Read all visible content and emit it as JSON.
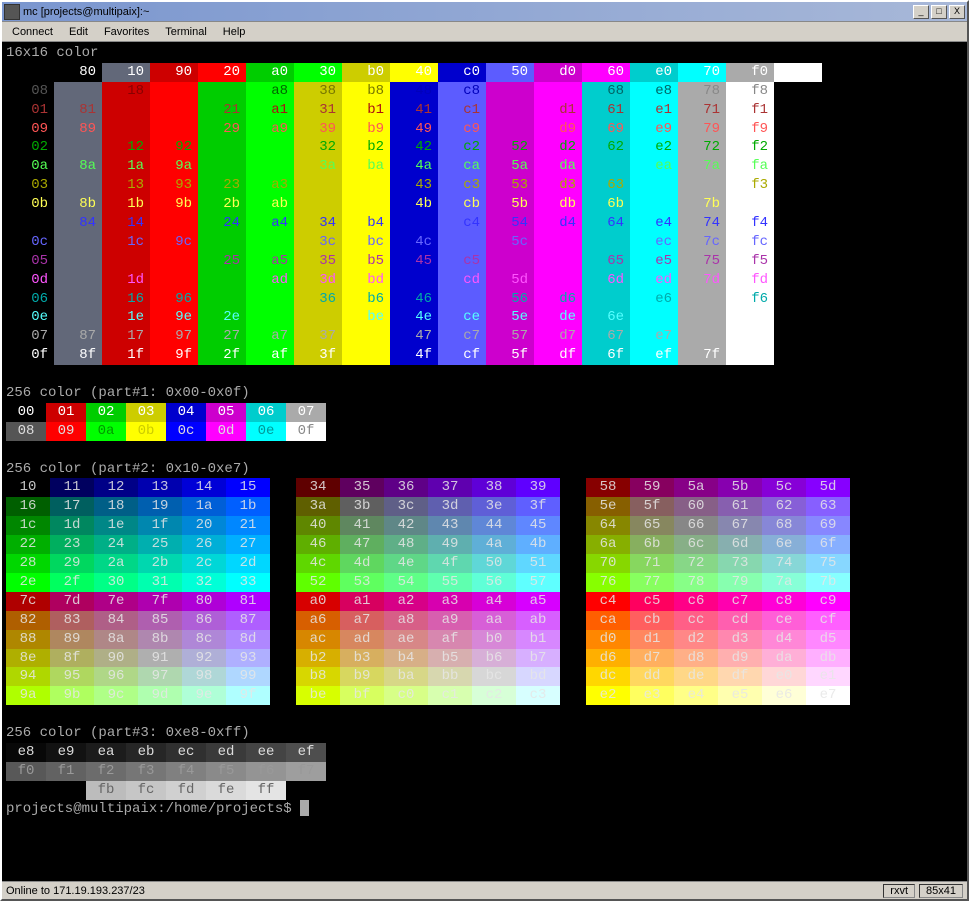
{
  "window": {
    "title": "mc [projects@multipaix]:~",
    "btn_min": "_",
    "btn_max": "□",
    "btn_close": "X"
  },
  "menu": [
    "Connect",
    "Edit",
    "Favorites",
    "Terminal",
    "Help"
  ],
  "term": {
    "h1": "16x16 color",
    "grid16_cols": [
      "",
      "80",
      "10",
      "90",
      "20",
      "a0",
      "30",
      "b0",
      "40",
      "c0",
      "50",
      "d0",
      "60",
      "e0",
      "70",
      "f0"
    ],
    "grid16_rows": [
      [
        "08",
        "",
        "18",
        "",
        "",
        "a8",
        "38",
        "b8",
        "48",
        "c8",
        "",
        "",
        "68",
        "e8",
        "78",
        "f8"
      ],
      [
        "01",
        "81",
        "",
        "",
        "21",
        "a1",
        "31",
        "b1",
        "41",
        "c1",
        "",
        "d1",
        "61",
        "e1",
        "71",
        "f1"
      ],
      [
        "09",
        "89",
        "",
        "",
        "29",
        "a9",
        "39",
        "b9",
        "49",
        "c9",
        "",
        "d9",
        "69",
        "e9",
        "79",
        "f9"
      ],
      [
        "02",
        "",
        "12",
        "92",
        "",
        "",
        "32",
        "b2",
        "42",
        "c2",
        "52",
        "d2",
        "62",
        "e2",
        "72",
        "f2"
      ],
      [
        "0a",
        "8a",
        "1a",
        "9a",
        "",
        "",
        "3a",
        "ba",
        "4a",
        "ca",
        "5a",
        "da",
        "",
        "ea",
        "7a",
        "fa"
      ],
      [
        "03",
        "",
        "13",
        "93",
        "23",
        "a3",
        "",
        "",
        "43",
        "c3",
        "53",
        "d3",
        "63",
        "",
        "",
        "f3"
      ],
      [
        "0b",
        "8b",
        "1b",
        "9b",
        "2b",
        "ab",
        "",
        "",
        "4b",
        "cb",
        "5b",
        "db",
        "6b",
        "",
        "7b",
        ""
      ],
      [
        "",
        "84",
        "14",
        "",
        "24",
        "a4",
        "34",
        "b4",
        "",
        "c4",
        "54",
        "d4",
        "64",
        "e4",
        "74",
        "f4"
      ],
      [
        "0c",
        "",
        "1c",
        "9c",
        "",
        "",
        "3c",
        "bc",
        "4c",
        "",
        "5c",
        "",
        "",
        "ec",
        "7c",
        "fc"
      ],
      [
        "05",
        "",
        "",
        "",
        "25",
        "a5",
        "35",
        "b5",
        "45",
        "c5",
        "",
        "",
        "65",
        "e5",
        "75",
        "f5"
      ],
      [
        "0d",
        "",
        "1d",
        "",
        "",
        "ad",
        "3d",
        "bd",
        "",
        "cd",
        "5d",
        "",
        "6d",
        "ed",
        "7d",
        "fd"
      ],
      [
        "06",
        "",
        "16",
        "96",
        "",
        "",
        "36",
        "b6",
        "46",
        "",
        "56",
        "d6",
        "",
        "e6",
        "",
        "f6"
      ],
      [
        "0e",
        "",
        "1e",
        "9e",
        "2e",
        "",
        "",
        "be",
        "4e",
        "ce",
        "5e",
        "de",
        "6e",
        "",
        "",
        ""
      ],
      [
        "07",
        "87",
        "17",
        "97",
        "27",
        "a7",
        "37",
        "",
        "47",
        "c7",
        "57",
        "d7",
        "67",
        "e7",
        "",
        ""
      ],
      [
        "0f",
        "8f",
        "1f",
        "9f",
        "2f",
        "af",
        "3f",
        "",
        "4f",
        "cf",
        "5f",
        "df",
        "6f",
        "ef",
        "7f",
        ""
      ]
    ],
    "grid16_rowfg": [
      [
        "#555",
        "#000",
        "#800",
        "#800",
        "#060",
        "#060",
        "#770",
        "#770",
        "#00b",
        "#00b",
        "#808",
        "#808",
        "#066",
        "#066",
        "#888",
        "#888"
      ],
      [
        "#a33",
        "#a33",
        "#800",
        "#800",
        "#a33",
        "#a11",
        "#a33",
        "#a11",
        "#a33",
        "#a33",
        "#808",
        "#a33",
        "#a33",
        "#a33",
        "#a33",
        "#a33"
      ],
      [
        "#f55",
        "#f55",
        "#800",
        "#800",
        "#f55",
        "#f55",
        "#f55",
        "#f55",
        "#f55",
        "#f55",
        "#808",
        "#f55",
        "#f55",
        "#f55",
        "#f55",
        "#f55"
      ],
      [
        "#0a0",
        "#000",
        "#0a0",
        "#0a0",
        "#060",
        "#060",
        "#0a0",
        "#0a0",
        "#0a0",
        "#0a0",
        "#0a0",
        "#0a0",
        "#0a0",
        "#0a0",
        "#0a0",
        "#0a0"
      ],
      [
        "#5f5",
        "#5f5",
        "#5f5",
        "#5f5",
        "#060",
        "#060",
        "#5f5",
        "#5f5",
        "#5f5",
        "#5f5",
        "#5f5",
        "#5f5",
        "#066",
        "#5f5",
        "#5f5",
        "#5f5"
      ],
      [
        "#aa0",
        "#000",
        "#aa0",
        "#aa0",
        "#aa0",
        "#aa0",
        "#770",
        "#770",
        "#aa0",
        "#aa0",
        "#aa0",
        "#aa0",
        "#aa0",
        "#066",
        "#888",
        "#aa0"
      ],
      [
        "#ff5",
        "#ff5",
        "#ff5",
        "#ff5",
        "#ff5",
        "#ff5",
        "#770",
        "#770",
        "#ff5",
        "#ff5",
        "#ff5",
        "#ff5",
        "#ff5",
        "#066",
        "#ff5",
        "#888"
      ],
      [
        "#00b",
        "#33f",
        "#33f",
        "#800",
        "#33f",
        "#33f",
        "#33f",
        "#33f",
        "#00b",
        "#33f",
        "#33f",
        "#33f",
        "#33f",
        "#33f",
        "#33f",
        "#33f"
      ],
      [
        "#66f",
        "#000",
        "#66f",
        "#66f",
        "#060",
        "#060",
        "#66f",
        "#66f",
        "#66f",
        "#00b",
        "#66f",
        "#808",
        "#066",
        "#66f",
        "#66f",
        "#66f"
      ],
      [
        "#a3a",
        "#000",
        "#800",
        "#800",
        "#a3a",
        "#a3a",
        "#a3a",
        "#a3a",
        "#a3a",
        "#a3a",
        "#808",
        "#808",
        "#a3a",
        "#a3a",
        "#a3a",
        "#a3a"
      ],
      [
        "#f5f",
        "#000",
        "#f5f",
        "#800",
        "#060",
        "#f5f",
        "#f5f",
        "#f5f",
        "#00b",
        "#f5f",
        "#f5f",
        "#808",
        "#f5f",
        "#f5f",
        "#f5f",
        "#f5f"
      ],
      [
        "#0aa",
        "#000",
        "#0aa",
        "#0aa",
        "#060",
        "#060",
        "#0aa",
        "#0aa",
        "#0aa",
        "#00b",
        "#0aa",
        "#0aa",
        "#066",
        "#0aa",
        "#888",
        "#0aa"
      ],
      [
        "#5ff",
        "#000",
        "#5ff",
        "#5ff",
        "#5ff",
        "#060",
        "#770",
        "#5ff",
        "#5ff",
        "#5ff",
        "#5ff",
        "#5ff",
        "#5ff",
        "#066",
        "#888",
        "#888"
      ],
      [
        "#aaa",
        "#aaa",
        "#aaa",
        "#aaa",
        "#aaa",
        "#aaa",
        "#aaa",
        "#770",
        "#aaa",
        "#aaa",
        "#aaa",
        "#aaa",
        "#aaa",
        "#aaa",
        "#888",
        "#888"
      ],
      [
        "#fff",
        "#fff",
        "#fff",
        "#fff",
        "#fff",
        "#fff",
        "#fff",
        "#770",
        "#fff",
        "#fff",
        "#fff",
        "#fff",
        "#fff",
        "#fff",
        "#fff",
        "#888"
      ]
    ],
    "h2": "256 color (part#1: 0x00-0x0f)",
    "p1_r1": [
      "00",
      "01",
      "02",
      "03",
      "04",
      "05",
      "06",
      "07"
    ],
    "p1_r1_bg": [
      "#000",
      "#cd0000",
      "#00cd00",
      "#cdcd00",
      "#0000cd",
      "#cd00cd",
      "#00cdcd",
      "#aaa"
    ],
    "p1_r2": [
      "08",
      "09",
      "0a",
      "0b",
      "0c",
      "0d",
      "0e",
      "0f"
    ],
    "p1_r2_bg": [
      "#555",
      "#ff0000",
      "#00ff00",
      "#ffff00",
      "#0000ff",
      "#ff00ff",
      "#00ffff",
      "#fff"
    ],
    "h3": "256 color (part#2: 0x10-0xe7)",
    "cube_start": 16,
    "h4": "256 color (part#3: 0xe8-0xff)",
    "p3_r1": [
      "e8",
      "e9",
      "ea",
      "eb",
      "ec",
      "ed",
      "ee",
      "ef"
    ],
    "p3_r2": [
      "f0",
      "f1",
      "f2",
      "f3",
      "f4",
      "f5",
      "f6",
      "f7"
    ],
    "p3_r3": [
      "",
      "",
      "fb",
      "fc",
      "fd",
      "fe",
      "ff",
      ""
    ],
    "prompt": "projects@multipaix:/home/projects$ "
  },
  "status": {
    "left": "Online to 171.19.193.237/23",
    "r1": "rxvt",
    "r2": "85x41"
  }
}
